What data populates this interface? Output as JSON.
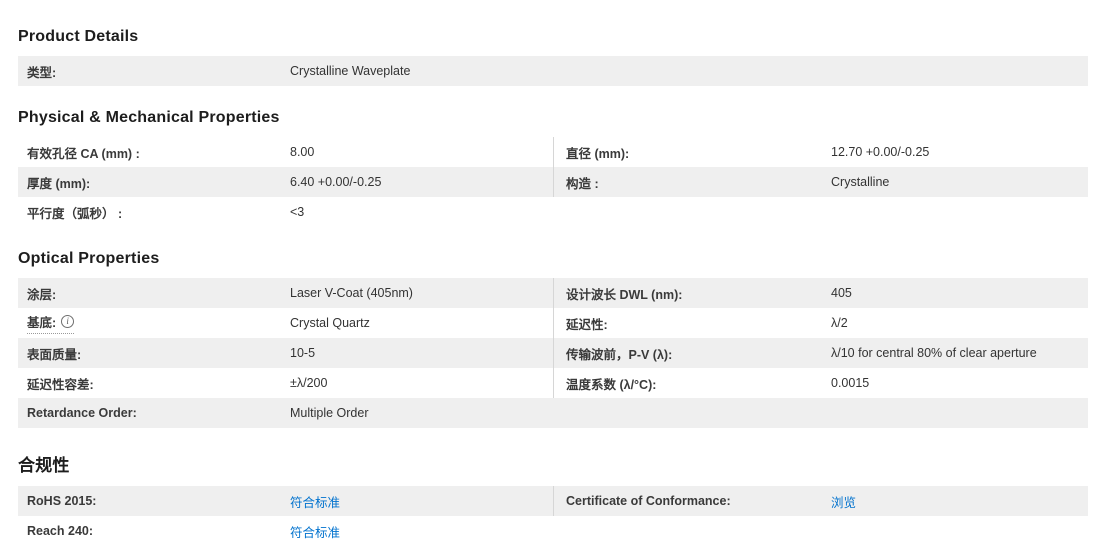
{
  "colors": {
    "row_alt_bg": "#efefef",
    "divider": "#d6d6d6",
    "heading_text": "#1d1d1d",
    "label_text": "#3a3a3a",
    "value_text": "#333333",
    "link_blue": "#0072ce"
  },
  "icons": {
    "info_glyph": "i"
  },
  "sections": [
    {
      "title": "Product Details",
      "rows": [
        {
          "left": {
            "label": "类型:",
            "value": "Crystalline Waveplate"
          }
        }
      ]
    },
    {
      "title": "Physical & Mechanical Properties",
      "rows": [
        {
          "left": {
            "label": "有效孔径 CA (mm) :",
            "value": "8.00"
          },
          "right": {
            "label": "直径 (mm):",
            "value": "12.70 +0.00/-0.25"
          }
        },
        {
          "left": {
            "label": "厚度 (mm):",
            "value": "6.40 +0.00/-0.25"
          },
          "right": {
            "label": "构造 :",
            "value": "Crystalline"
          }
        },
        {
          "left": {
            "label": "平行度（弧秒） :",
            "value": "<3"
          }
        }
      ]
    },
    {
      "title": "Optical Properties",
      "rows": [
        {
          "left": {
            "label": "涂层:",
            "value": "Laser V-Coat (405nm)"
          },
          "right": {
            "label": "设计波长 DWL (nm):",
            "value": "405"
          }
        },
        {
          "left": {
            "label": "基底:",
            "value": "Crystal Quartz",
            "has_info_icon": true
          },
          "right": {
            "label": "延迟性:",
            "value": "λ/2"
          }
        },
        {
          "left": {
            "label": "表面质量:",
            "value": "10-5"
          },
          "right": {
            "label": "传输波前，P-V (λ):",
            "value": "λ/10 for central 80% of clear aperture"
          }
        },
        {
          "left": {
            "label": "延迟性容差:",
            "value": "±λ/200"
          },
          "right": {
            "label": "温度系数 (λ/°C):",
            "value": "0.0015"
          }
        },
        {
          "left": {
            "label": "Retardance Order:",
            "value": "Multiple Order"
          }
        }
      ]
    },
    {
      "title": "合规性",
      "rows": [
        {
          "left": {
            "label": "RoHS 2015:",
            "value": "符合标准",
            "is_link": true
          },
          "right": {
            "label": "Certificate of Conformance:",
            "value": "浏览",
            "is_link": true
          }
        },
        {
          "left": {
            "label": "Reach 240:",
            "value": "符合标准",
            "is_link": true
          }
        }
      ]
    }
  ]
}
